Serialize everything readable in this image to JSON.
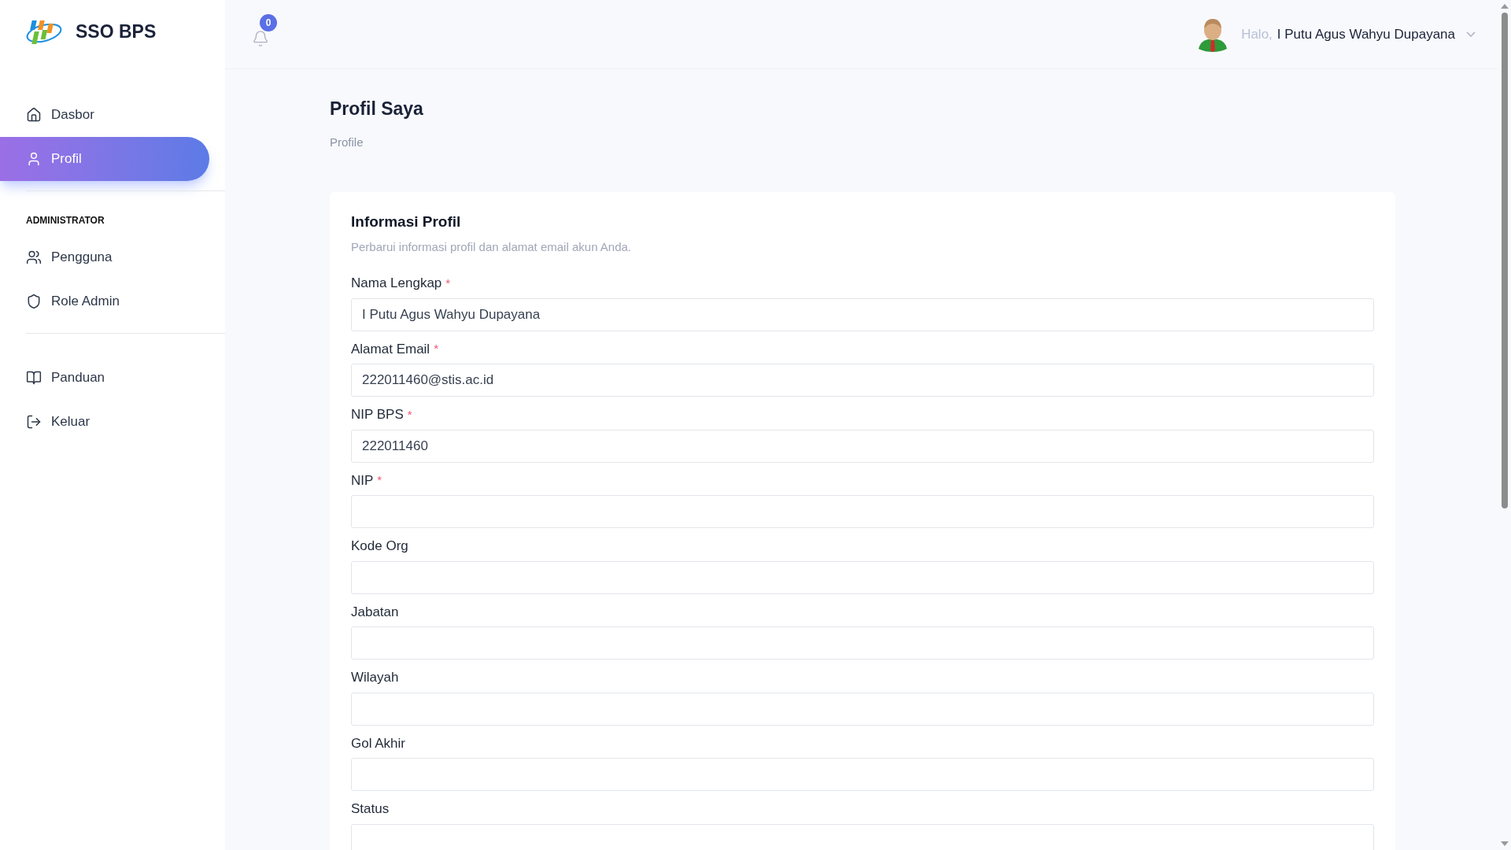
{
  "brand": {
    "name": "SSO BPS"
  },
  "sidebar": {
    "items": [
      {
        "label": "Dasbor",
        "selected": false
      },
      {
        "label": "Profil",
        "selected": true
      }
    ],
    "section_title": "ADMINISTRATOR",
    "admin_items": [
      {
        "label": "Pengguna",
        "selected": false
      },
      {
        "label": "Role Admin",
        "selected": false
      }
    ],
    "bottom_items": [
      {
        "label": "Panduan",
        "selected": false
      },
      {
        "label": "Keluar",
        "selected": false
      }
    ]
  },
  "header": {
    "notification_count": "0",
    "greeting": "Halo,",
    "user_name": "I Putu Agus Wahyu Dupayana"
  },
  "page": {
    "title": "Profil Saya",
    "breadcrumb": "Profile"
  },
  "card": {
    "title": "Informasi Profil",
    "subtitle": "Perbarui informasi profil dan alamat email akun Anda.",
    "fields": [
      {
        "label": "Nama Lengkap",
        "required_mark": "*",
        "value": "I Putu Agus Wahyu Dupayana"
      },
      {
        "label": "Alamat Email",
        "required_mark": "*",
        "value": "222011460@stis.ac.id"
      },
      {
        "label": "NIP BPS",
        "required_mark": "*",
        "value": "222011460"
      },
      {
        "label": "NIP",
        "required_mark": "*"
      },
      {
        "label": "Kode Org"
      },
      {
        "label": "Jabatan"
      },
      {
        "label": "Wilayah"
      },
      {
        "label": "Gol Akhir"
      },
      {
        "label": "Status"
      }
    ]
  }
}
